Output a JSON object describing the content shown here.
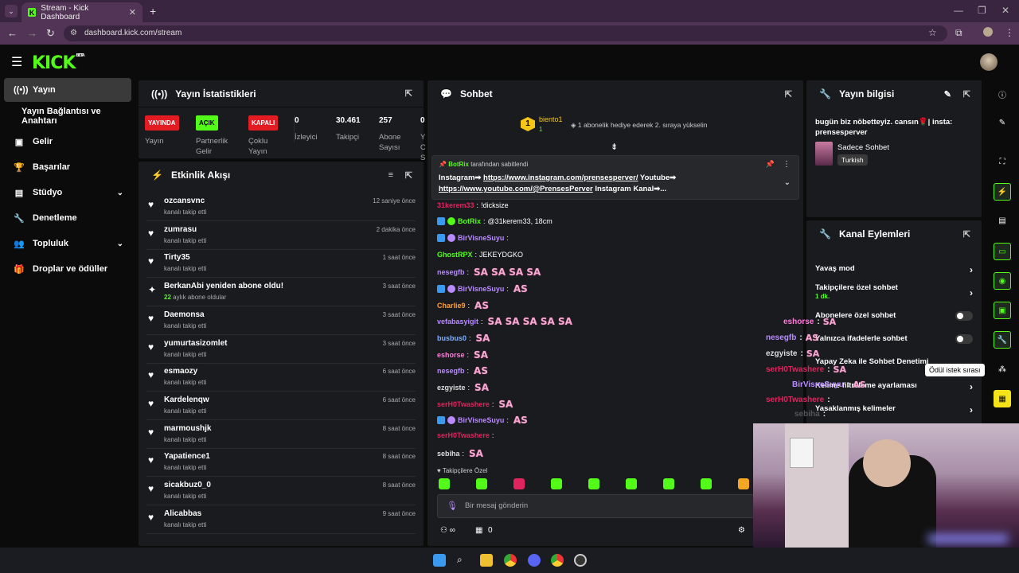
{
  "browser": {
    "tab_title": "Stream - Kick Dashboard",
    "url": "dashboard.kick.com/stream"
  },
  "header": {
    "logo": "KICK",
    "logo_sup": "BETA"
  },
  "sidebar": {
    "items": [
      {
        "label": "Yayın"
      },
      {
        "label": "Yayın Bağlantısı ve Anahtarı"
      },
      {
        "label": "Gelir"
      },
      {
        "label": "Başarılar"
      },
      {
        "label": "Stüdyo"
      },
      {
        "label": "Denetleme"
      },
      {
        "label": "Topluluk"
      },
      {
        "label": "Droplar ve ödüller"
      }
    ]
  },
  "stats": {
    "title": "Yayın İstatistikleri",
    "status1": "YAYINDA",
    "status1_label": "Yayın",
    "status2": "AÇIK",
    "status2_label1": "Partnerlik",
    "status2_label2": "Gelir",
    "status3": "KAPALI",
    "status3_label1": "Çoklu",
    "status3_label2": "Yayın",
    "viewers": "0",
    "viewers_label": "İzleyici",
    "followers": "30.461",
    "followers_label": "Takipçi",
    "subs": "257",
    "subs_label1": "Abone",
    "subs_label2": "Sayısı",
    "last": "0",
    "last_label1": "Y",
    "last_label2": "O",
    "last_label3": "S"
  },
  "activity": {
    "title": "Etkinlik Akışı",
    "items": [
      {
        "name": "ozcansvnc",
        "sub": "kanalı takip etti",
        "time": "12 saniye önce"
      },
      {
        "name": "zumrasu",
        "sub": "kanalı takip etti",
        "time": "2 dakika önce"
      },
      {
        "name": "Tirty35",
        "sub": "kanalı takip etti",
        "time": "1 saat önce"
      },
      {
        "name": "BerkanAbi yeniden abone oldu!",
        "sub_num": "22",
        "sub": "aylık abone oldular",
        "time": "3 saat önce"
      },
      {
        "name": "Daemonsa",
        "sub": "kanalı takip etti",
        "time": "3 saat önce"
      },
      {
        "name": "yumurtasizomlet",
        "sub": "kanalı takip etti",
        "time": "3 saat önce"
      },
      {
        "name": "esmaozy",
        "sub": "kanalı takip etti",
        "time": "6 saat önce"
      },
      {
        "name": "Kardelenqw",
        "sub": "kanalı takip etti",
        "time": "6 saat önce"
      },
      {
        "name": "marmoushjk",
        "sub": "kanalı takip etti",
        "time": "8 saat önce"
      },
      {
        "name": "Yapatience1",
        "sub": "kanalı takip etti",
        "time": "8 saat önce"
      },
      {
        "name": "sicakbuz0_0",
        "sub": "kanalı takip etti",
        "time": "8 saat önce"
      },
      {
        "name": "Alicabbas",
        "sub": "kanalı takip etti",
        "time": "9 saat önce"
      }
    ]
  },
  "chat": {
    "title": "Sohbet",
    "hype_user": "biento1",
    "hype_count": "1",
    "hype_text": "1 abonelik hediye ederek 2. sıraya yükselin",
    "pinned_by": "BotRix",
    "pinned_suffix": "tarafından sabitlendi",
    "pinned_line1_a": "Instagram➡ ",
    "pinned_line1_link": "https://www.instagram.com/prensesperver/",
    "pinned_line1_b": " Youtube➡",
    "pinned_line2_link": "https://www.youtube.com/@PrensesPerver",
    "pinned_line2_b": " Instagram Kanal➡...",
    "messages": [
      {
        "user": "31kerem33",
        "color": "#e0245e",
        "text": "!dicksize"
      },
      {
        "user": "BotRix",
        "color": "#53fc18",
        "text": "@31kerem33, 18cm"
      },
      {
        "user": "BirVisneSuyu",
        "color": "#b98bff",
        "text": ""
      },
      {
        "user": "GhostRPX",
        "color": "#53fc18",
        "text": "JEKEYDGKO"
      },
      {
        "user": "nesegfb",
        "color": "#b98bff",
        "text": "",
        "emote": "SA SA SA SA"
      },
      {
        "user": "BirVisneSuyu",
        "color": "#b98bff",
        "text": "",
        "emote": "AS"
      },
      {
        "user": "Charlie9",
        "color": "#ff9e3d",
        "text": "",
        "emote": "AS"
      },
      {
        "user": "vefabasyigit",
        "color": "#b98bff",
        "text": "",
        "emote": "SA SA SA SA SA"
      },
      {
        "user": "busbus0",
        "color": "#7fb0ff",
        "text": "",
        "emote": "SA"
      },
      {
        "user": "eshorse",
        "color": "#ff7ad9",
        "text": "",
        "emote": "SA"
      },
      {
        "user": "nesegfb",
        "color": "#b98bff",
        "text": "",
        "emote": "AS"
      },
      {
        "user": "ezgyiste",
        "color": "#dddddd",
        "text": "",
        "emote": "SA"
      },
      {
        "user": "serH0Twashere",
        "color": "#e0245e",
        "text": "",
        "emote": "SA"
      },
      {
        "user": "BirVisneSuyu",
        "color": "#b98bff",
        "text": "",
        "emote": "AS"
      },
      {
        "user": "serH0Twashere",
        "color": "#e0245e",
        "text": ""
      },
      {
        "user": "sebiha",
        "color": "#dddddd",
        "text": "",
        "emote": "SA"
      }
    ],
    "mode_label": "Takipçilere Özel",
    "input_placeholder": "Bir mesaj gönderin",
    "points": "0"
  },
  "info": {
    "title": "Yayın bilgisi",
    "desc": "bugün biz nöbetteyiz. cansın🌹| insta: prensesperver",
    "category": "Sadece Sohbet",
    "tag": "Turkish"
  },
  "actions": {
    "title": "Kanal Eylemleri",
    "rows": [
      {
        "label": "Yavaş mod"
      },
      {
        "label": "Takipçilere özel sohbet",
        "sub": "1 dk."
      },
      {
        "label": "Abonelere özel sohbet"
      },
      {
        "label": "Yalnızca ifadelerle sohbet"
      },
      {
        "label": "Yapay Zeka ile Sohbet Denetimi"
      },
      {
        "label": "Kelime filtreleme ayarlaması"
      },
      {
        "label": "Yasaklanmış kelimeler"
      }
    ]
  },
  "tooltip": "Ödül istek sırası",
  "overlay_chat": [
    {
      "user": "eshorse",
      "emote": "SA"
    },
    {
      "user": "nesegfb",
      "emote": "AS"
    },
    {
      "user": "ezgyiste",
      "emote": "SA"
    },
    {
      "user": "serH0Twashere",
      "emote": "SA"
    },
    {
      "user": "BirVisneSuyu",
      "emote": "AS"
    },
    {
      "user": "serH0Twashere",
      "emote": ""
    },
    {
      "user": "sebiha",
      "emote": ""
    }
  ]
}
